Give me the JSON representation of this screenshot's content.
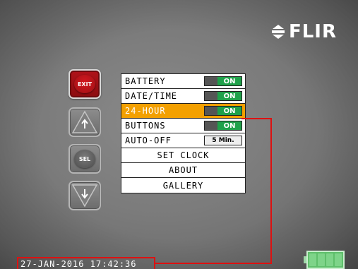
{
  "brand": {
    "logo_text": "FLIR",
    "logo_icon": "flir-logo-icon"
  },
  "side_buttons": {
    "exit_label": "EXIT",
    "up_icon": "arrow-up-icon",
    "select_label": "SEL",
    "down_icon": "arrow-down-icon"
  },
  "menu": {
    "items": [
      {
        "label": "BATTERY",
        "control": "toggle",
        "value": "ON"
      },
      {
        "label": "DATE/TIME",
        "control": "toggle",
        "value": "ON"
      },
      {
        "label": "24-HOUR",
        "control": "toggle",
        "value": "ON",
        "selected": true
      },
      {
        "label": "BUTTONS",
        "control": "toggle",
        "value": "ON"
      },
      {
        "label": "AUTO-OFF",
        "control": "timer",
        "value": "5 Min."
      },
      {
        "label": "SET CLOCK",
        "control": "none"
      },
      {
        "label": "ABOUT",
        "control": "none"
      },
      {
        "label": "GALLERY",
        "control": "none"
      }
    ]
  },
  "status": {
    "datetime": "27-JAN-2016 17:42:36",
    "battery_level": 1.0,
    "battery_cells": 4
  },
  "colors": {
    "highlight": "#f3a000",
    "on": "#1fa14a",
    "exit": "#b0131a",
    "connector": "#dd1111",
    "battery": "#5fbf6b"
  }
}
